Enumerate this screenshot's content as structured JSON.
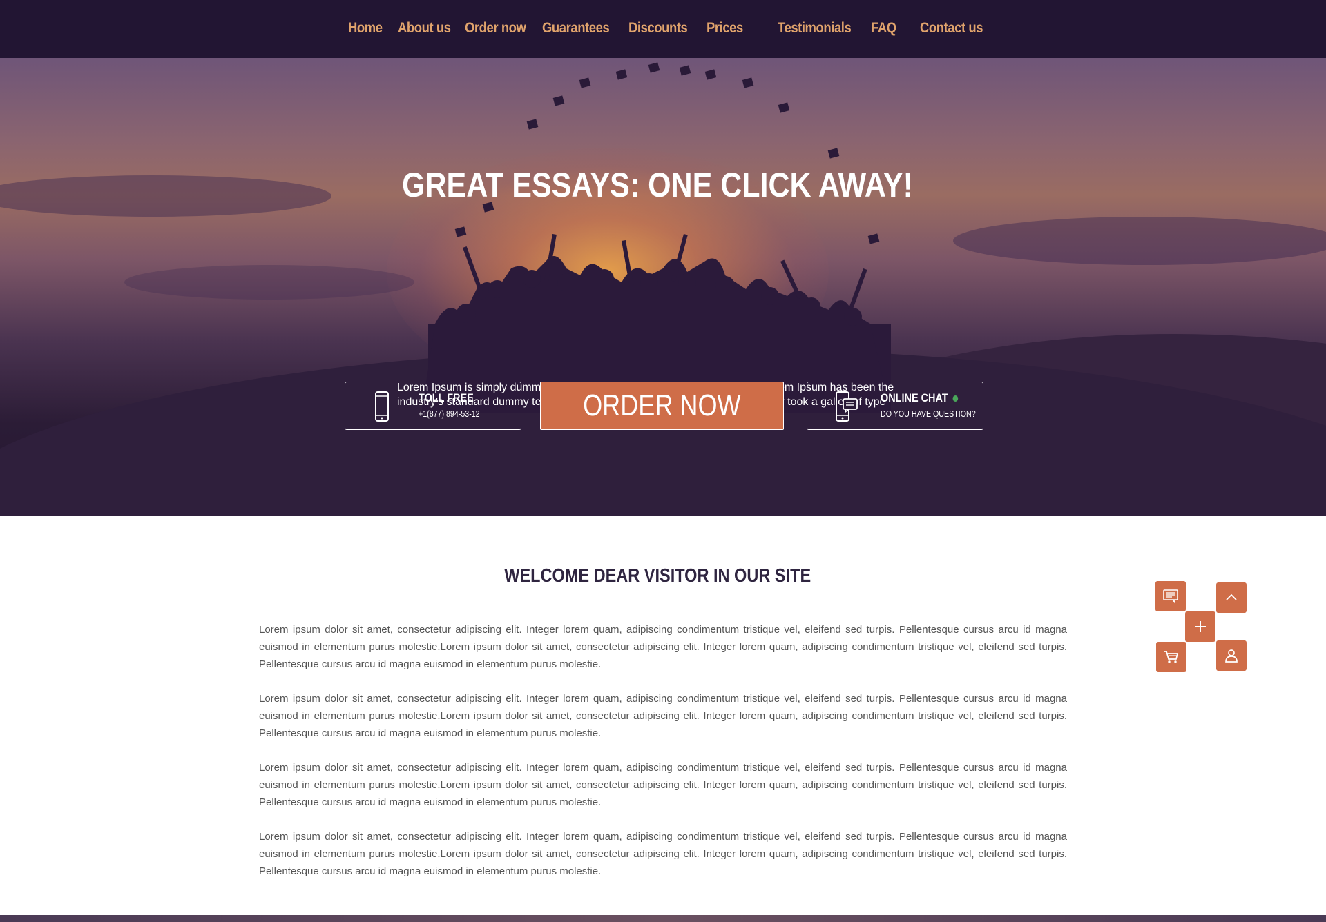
{
  "nav": {
    "items": [
      {
        "label": "Home"
      },
      {
        "label": "About us"
      },
      {
        "label": "Order now"
      },
      {
        "label": "Guarantees"
      },
      {
        "label": "Discounts"
      },
      {
        "label": "Prices"
      },
      {
        "label": "Testimonials"
      },
      {
        "label": "FAQ"
      },
      {
        "label": "Contact us"
      }
    ]
  },
  "hero": {
    "title": "GREAT ESSAYS: ONE CLICK AWAY!",
    "description": "Lorem Ipsum is simply dummy text of the printing and typesetting industry. Lorem Ipsum has been the industry's standard dummy text ever since the 1500s, when an unknown printer took a galley of type",
    "toll_free": {
      "label": "TOLL FREE",
      "phone": "+1(877) 894-53-12",
      "icon": "phone-icon"
    },
    "order_button": "ORDER NOW",
    "online_chat": {
      "label": "ONLINE CHAT",
      "sub": "DO YOU HAVE QUESTION?",
      "icon": "chat-phone-icon",
      "status_color": "#4aa65a"
    }
  },
  "main": {
    "heading": "WELCOME DEAR VISITOR IN OUR SITE",
    "paragraphs": [
      "Lorem ipsum dolor sit amet, consectetur adipiscing elit. Integer lorem quam, adipiscing condimentum tristique vel, eleifend sed turpis. Pellentesque cursus arcu id magna euismod in elementum purus molestie.Lorem ipsum dolor sit amet, consectetur adipiscing elit. Integer lorem quam, adipiscing condimentum tristique vel, eleifend sed turpis. Pellentesque cursus arcu id magna euismod in elementum purus molestie.",
      "Lorem ipsum dolor sit amet, consectetur adipiscing elit. Integer lorem quam, adipiscing condimentum tristique vel, eleifend sed turpis. Pellentesque cursus arcu id magna euismod in elementum purus molestie.Lorem ipsum dolor sit amet, consectetur adipiscing elit. Integer lorem quam, adipiscing condimentum tristique vel, eleifend sed turpis. Pellentesque cursus arcu id magna euismod in elementum purus molestie.",
      "Lorem ipsum dolor sit amet, consectetur adipiscing elit. Integer lorem quam, adipiscing condimentum tristique vel, eleifend sed turpis. Pellentesque cursus arcu id magna euismod in elementum purus molestie.Lorem ipsum dolor sit amet, consectetur adipiscing elit. Integer lorem quam, adipiscing condimentum tristique vel, eleifend sed turpis. Pellentesque cursus arcu id magna euismod in elementum purus molestie.",
      "Lorem ipsum dolor sit amet, consectetur adipiscing elit. Integer lorem quam, adipiscing condimentum tristique vel, eleifend sed turpis. Pellentesque cursus arcu id magna euismod in elementum purus molestie.Lorem ipsum dolor sit amet, consectetur adipiscing elit. Integer lorem quam, adipiscing condimentum tristique vel, eleifend sed turpis. Pellentesque cursus arcu id magna euismod in elementum purus molestie."
    ]
  },
  "widget": {
    "icons": [
      "chat-icon",
      "arrow-up-icon",
      "plus-icon",
      "cart-icon",
      "user-icon"
    ]
  },
  "colors": {
    "nav_bg": "#221533",
    "nav_text": "#e0a36c",
    "accent": "#cf6d48",
    "heading": "#2f2540"
  }
}
